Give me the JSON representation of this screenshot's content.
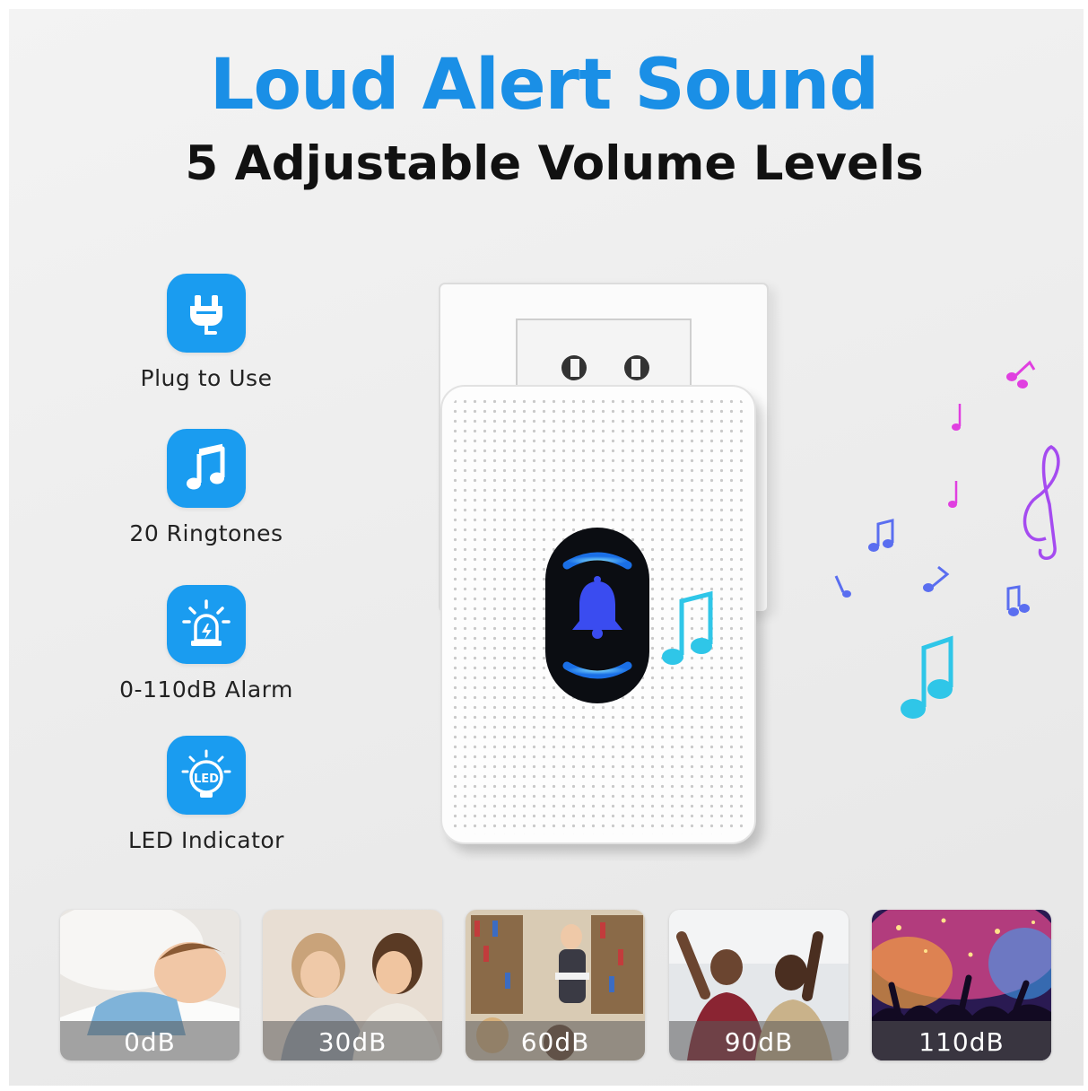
{
  "header": {
    "title": "Loud Alert Sound",
    "subtitle": "5 Adjustable Volume Levels"
  },
  "colors": {
    "accent": "#1a8fe6",
    "badge": "#1a9cf0",
    "text": "#111111"
  },
  "features": [
    {
      "icon": "plug-icon",
      "label": "Plug to Use"
    },
    {
      "icon": "music-note-icon",
      "label": "20 Ringtones"
    },
    {
      "icon": "alarm-light-icon",
      "label": "0-110dB Alarm"
    },
    {
      "icon": "led-bulb-icon",
      "label": "LED Indicator"
    }
  ],
  "volume_levels": [
    {
      "label": "0dB"
    },
    {
      "label": "30dB"
    },
    {
      "label": "60dB"
    },
    {
      "label": "90dB"
    },
    {
      "label": "110dB"
    }
  ]
}
